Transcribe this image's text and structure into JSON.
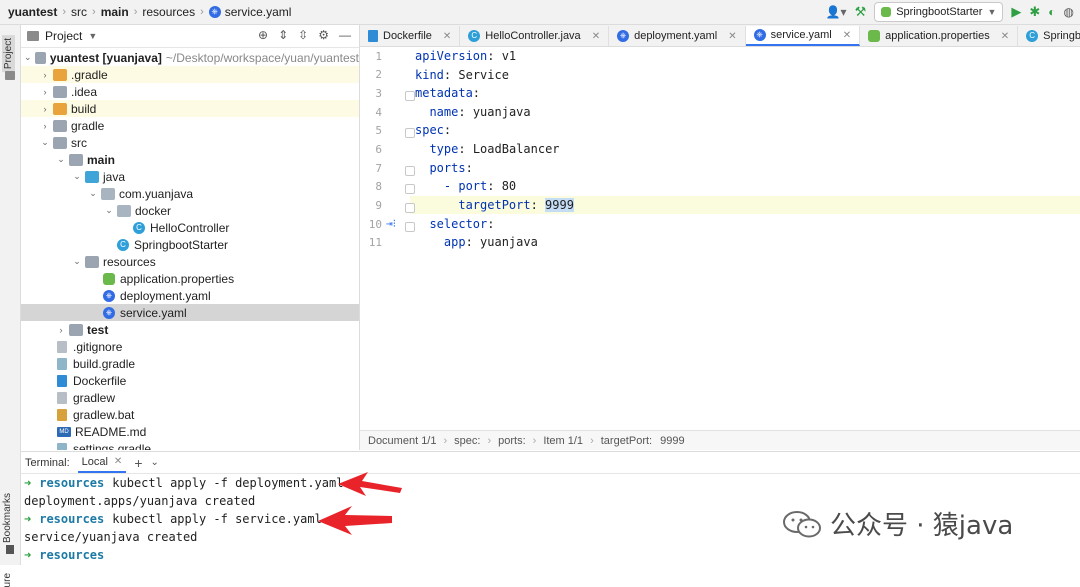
{
  "breadcrumb": {
    "project": "yuantest",
    "src": "src",
    "main": "main",
    "resources": "resources",
    "file": "service.yaml"
  },
  "toolbar": {
    "run_config": "SpringbootStarter"
  },
  "side_labels": {
    "project": "Project",
    "bookmarks": "Bookmarks",
    "structure": "ure"
  },
  "project_panel": {
    "title": "Project",
    "root": {
      "name": "yuantest [yuanjava]",
      "path": "~/Desktop/workspace/yuan/yuantest"
    },
    "items": [
      {
        "label": ".gradle"
      },
      {
        "label": ".idea"
      },
      {
        "label": "build"
      },
      {
        "label": "gradle"
      },
      {
        "label": "src"
      },
      {
        "label": "main"
      },
      {
        "label": "java"
      },
      {
        "label": "com.yuanjava"
      },
      {
        "label": "docker"
      },
      {
        "label": "HelloController"
      },
      {
        "label": "SpringbootStarter"
      },
      {
        "label": "resources"
      },
      {
        "label": "application.properties"
      },
      {
        "label": "deployment.yaml"
      },
      {
        "label": "service.yaml"
      },
      {
        "label": "test"
      },
      {
        "label": ".gitignore"
      },
      {
        "label": "build.gradle"
      },
      {
        "label": "Dockerfile"
      },
      {
        "label": "gradlew"
      },
      {
        "label": "gradlew.bat"
      },
      {
        "label": "README.md"
      },
      {
        "label": "settings.gradle"
      }
    ]
  },
  "editor_tabs": [
    {
      "label": "Dockerfile"
    },
    {
      "label": "HelloController.java"
    },
    {
      "label": "deployment.yaml"
    },
    {
      "label": "service.yaml"
    },
    {
      "label": "application.properties"
    },
    {
      "label": "SpringbootStarter.java"
    }
  ],
  "editor": {
    "line_numbers": [
      "1",
      "2",
      "3",
      "4",
      "5",
      "6",
      "7",
      "8",
      "9",
      "10",
      "11"
    ],
    "lines": [
      {
        "key": "apiVersion",
        "val": " v1"
      },
      {
        "key": "kind",
        "val": " Service"
      },
      {
        "key": "metadata",
        "val": ""
      },
      {
        "key": "  name",
        "val": " yuanjava"
      },
      {
        "key": "spec",
        "val": ""
      },
      {
        "key": "  type",
        "val": " LoadBalancer"
      },
      {
        "key": "  ports",
        "val": ""
      },
      {
        "key": "    - port",
        "val": " 80"
      },
      {
        "key": "      targetPort",
        "val": "9999"
      },
      {
        "key": "  selector",
        "val": ""
      },
      {
        "key": "    app",
        "val": " yuanjava"
      }
    ]
  },
  "editor_breadcrumbs": [
    "Document 1/1",
    "spec:",
    "ports:",
    "Item 1/1",
    "targetPort:",
    "9999"
  ],
  "terminal": {
    "title": "Terminal:",
    "tab": "Local",
    "lines": [
      {
        "dir": "resources",
        "cmd": "kubectl apply -f deployment.yaml"
      },
      {
        "out": "deployment.apps/yuanjava created"
      },
      {
        "dir": "resources",
        "cmd": "kubectl apply -f service.yaml"
      },
      {
        "out": "service/yuanjava created"
      },
      {
        "dir": "resources",
        "cmd": ""
      }
    ]
  },
  "watermark": {
    "text": "公众号 · 猿java"
  }
}
